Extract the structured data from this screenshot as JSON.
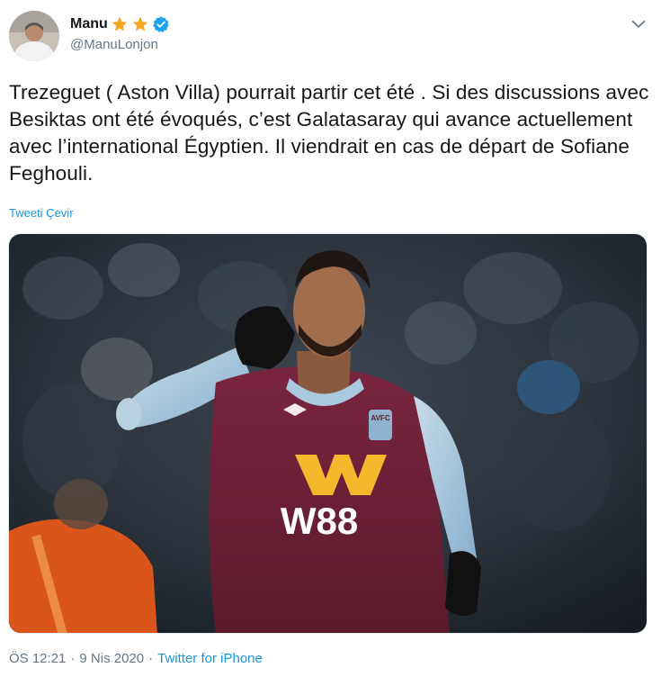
{
  "author": {
    "display_name": "Manu",
    "handle": "@ManuLonjon",
    "star_icon": "star-icon",
    "verified_icon": "verified-badge-icon"
  },
  "tweet": {
    "text": "Trezeguet ( Aston Villa) pourrait partir cet été . Si des discussions avec Besiktas ont été évoqués, c’est  Galatasaray qui avance actuellement avec l’international Égyptien. Il viendrait en cas de départ de Sofiane Feghouli.",
    "translate_label": "Tweeti Çevir"
  },
  "media": {
    "jersey_sponsor": "W88",
    "crest_text": "AVFC"
  },
  "footer": {
    "time": "ÖS 12:21",
    "separator": "·",
    "date": "9 Nis 2020",
    "source": "Twitter for iPhone"
  },
  "colors": {
    "link": "#1b95e0",
    "secondary": "#657786",
    "star": "#f5a623",
    "verified": "#1da1f2",
    "claret": "#6b1e34",
    "sky_blue": "#9fc3dc"
  }
}
